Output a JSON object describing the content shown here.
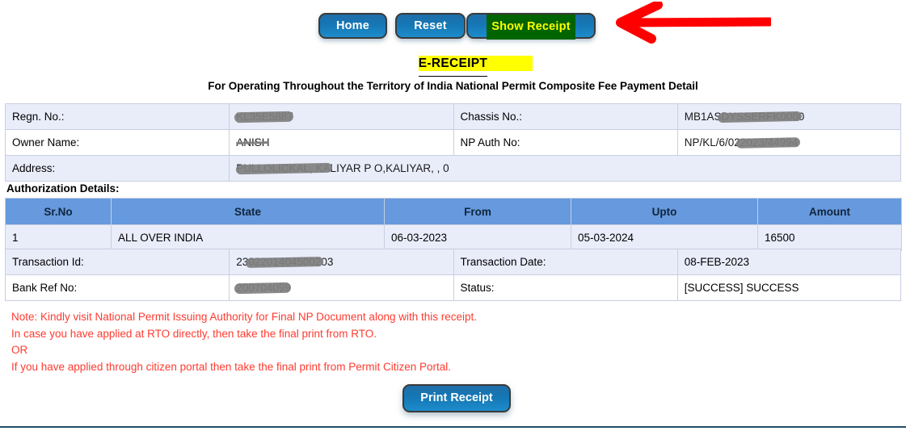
{
  "toolbar": {
    "home_label": "Home",
    "reset_label": "Reset",
    "show_receipt_label": "Show Receipt"
  },
  "annotation": {
    "arrow_color": "#ff0000",
    "arrow_direction": "left"
  },
  "header": {
    "receipt_title": "E-RECEIPT",
    "highlight_color": "#ffff00",
    "subtitle": "For Operating Throughout the Territory of India National Permit Composite Fee Payment Detail"
  },
  "details_top": [
    {
      "label_left": "Regn. No.:",
      "value_left": "KL35E5887",
      "label_right": "Chassis No.:",
      "value_right": "MB1ASDYSSERFK0000"
    },
    {
      "label_left": "Owner Name:",
      "value_left": "ANISH",
      "label_right": "NP Auth No:",
      "value_right": "NP/KL/6/022023/44994"
    },
    {
      "label_left": "Address:",
      "value_left": "PULLOLICKAL, KALIYAR P O,KALIYAR, , 0",
      "label_right": "",
      "value_right": ""
    }
  ],
  "authorization": {
    "heading": "Authorization Details:",
    "columns": [
      "Sr.No",
      "State",
      "From",
      "Upto",
      "Amount"
    ],
    "rows": [
      {
        "sr_no": "1",
        "state": "ALL OVER INDIA",
        "from": "06-03-2023",
        "upto": "05-03-2024",
        "amount": "16500"
      }
    ],
    "header_color": "#6699dd"
  },
  "details_bottom": [
    {
      "label_left": "Transaction Id:",
      "value_left": "2302201404500203",
      "label_right": "Transaction Date:",
      "value_right": "08-FEB-2023"
    },
    {
      "label_left": "Bank Ref No:",
      "value_left": "200704099",
      "label_right": "Status:",
      "value_right": "[SUCCESS] SUCCESS"
    }
  ],
  "notes": {
    "color": "#ff3b30",
    "lines": [
      "Note: Kindly visit National Permit Issuing Authority for Final NP Document along with this receipt.",
      "In case you have applied at RTO directly, then take the final print from RTO.",
      "OR",
      "If you have applied through citizen portal then take the final print from Permit Citizen Portal."
    ]
  },
  "footer": {
    "print_label": "Print Receipt"
  }
}
